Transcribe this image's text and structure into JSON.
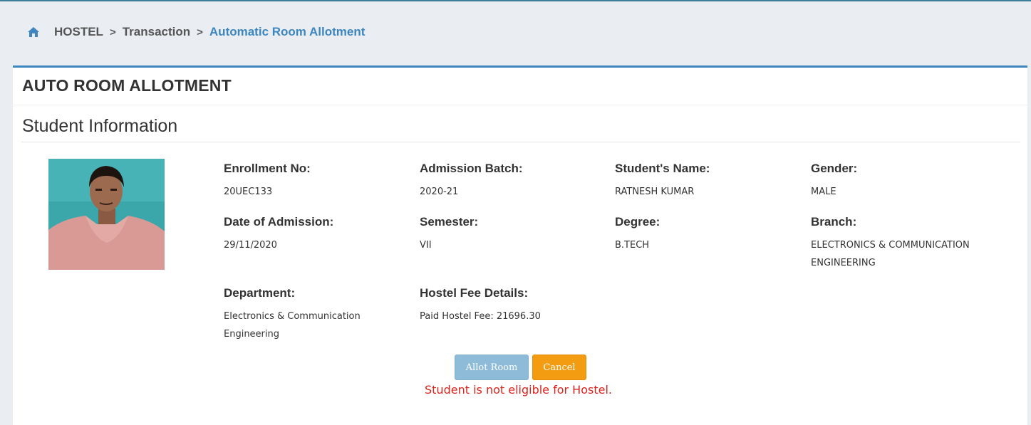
{
  "breadcrumb": {
    "home_icon": "home-icon",
    "items": [
      "HOSTEL",
      "Transaction",
      "Automatic Room Allotment"
    ],
    "separator": ">"
  },
  "panel": {
    "title": "AUTO ROOM ALLOTMENT",
    "section_title": "Student Information"
  },
  "student": {
    "enrollment_label": "Enrollment No:",
    "enrollment_value": "20UEC133",
    "batch_label": "Admission Batch:",
    "batch_value": "2020-21",
    "name_label": "Student's Name:",
    "name_value": "RATNESH KUMAR",
    "gender_label": "Gender:",
    "gender_value": "MALE",
    "doa_label": "Date of Admission:",
    "doa_value": "29/11/2020",
    "semester_label": "Semester:",
    "semester_value": "VII",
    "degree_label": "Degree:",
    "degree_value": "B.TECH",
    "branch_label": "Branch:",
    "branch_value": "ELECTRONICS & COMMUNICATION ENGINEERING",
    "department_label": "Department:",
    "department_value": "Electronics & Communication Engineering",
    "fee_label": "Hostel Fee Details:",
    "fee_value": "Paid Hostel Fee: 21696.30"
  },
  "actions": {
    "allot_label": "Allot Room",
    "cancel_label": "Cancel",
    "error_message": "Student is not eligible for Hostel."
  },
  "colors": {
    "accent": "#3d86c0",
    "cancel": "#f39c12",
    "allot_disabled": "#8dbbd8",
    "error": "#d9241c"
  }
}
